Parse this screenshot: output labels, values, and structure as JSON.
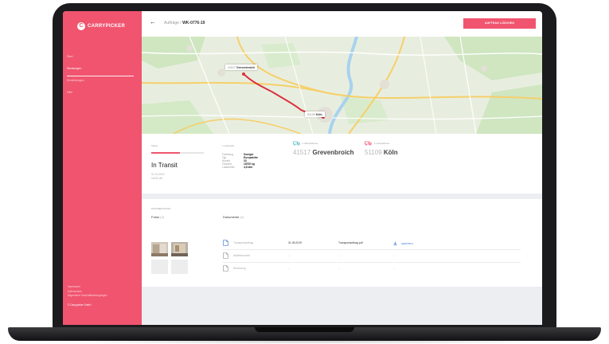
{
  "brand": {
    "name": "CARRYPICKER",
    "accent_color": "#f0546f",
    "link_color": "#4a7fd8"
  },
  "sidebar": {
    "items": [
      {
        "label": "Start",
        "active": false
      },
      {
        "label": "Sendungen",
        "active": true
      },
      {
        "label": "Einstellungen",
        "active": false
      },
      {
        "label": "Hilfe",
        "active": false
      }
    ],
    "footer_links": [
      "Impressum",
      "Datenschutz",
      "Allgemeine Geschäftsbedingungen"
    ],
    "copyright": "© Carrypicker GmbH"
  },
  "topbar": {
    "breadcrumb_parent": "Aufträge",
    "breadcrumb_separator": " / ",
    "breadcrumb_current": "WK-0776-19",
    "action_label": "AUFTRAG LÖSCHEN"
  },
  "map": {
    "origin_label": {
      "zip": "41517",
      "city": "Grevenbroich"
    },
    "destination_label": {
      "zip": "51109",
      "city": "Köln"
    }
  },
  "status": {
    "label": "Status",
    "value": "In Transit",
    "progress": 0.55,
    "date": "01.01.2019",
    "time": "18:00 Uhr"
  },
  "load": {
    "label": "1 Ladestelle",
    "rows": [
      {
        "key": "Fahrzeug",
        "value": "Sweiger"
      },
      {
        "key": "Typ",
        "value": "Europalette"
      },
      {
        "key": "Anzahl",
        "value": "33"
      },
      {
        "key": "Gewicht",
        "value": "18700 kg"
      },
      {
        "key": "Lademeter",
        "value": "4,8 ldm"
      }
    ]
  },
  "pickup": {
    "label": "1 Abholadresse",
    "zip": "41517",
    "city": "Grevenbroich",
    "icon_color": "#5bb8c4"
  },
  "delivery": {
    "label": "1 Lieferadresse",
    "zip": "51109",
    "city": "Köln",
    "icon_color": "#f0546f"
  },
  "documents": {
    "section_label": "DOKUMENTATION",
    "photos_label": "Fotos",
    "photos_count": "(2)",
    "docs_label": "Dokumente",
    "docs_count": "(1)",
    "rows": [
      {
        "name": "Transportauftrag",
        "date": "31.05.2019",
        "file": "Transportauftrag.pdf",
        "action": "speichern"
      },
      {
        "name": "Ablieferschein",
        "date": "–",
        "file": "–",
        "action": "–"
      },
      {
        "name": "Rechnung",
        "date": "–",
        "file": "–",
        "action": "–"
      }
    ]
  }
}
